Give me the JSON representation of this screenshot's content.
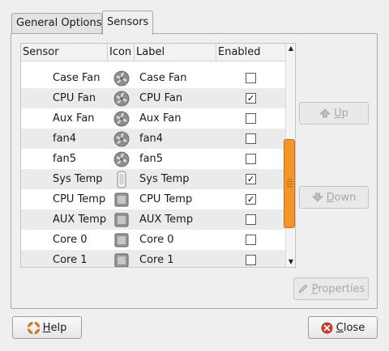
{
  "tabs": [
    {
      "label": "General Options",
      "active": false
    },
    {
      "label": "Sensors",
      "active": true
    }
  ],
  "table": {
    "columns": [
      "Sensor",
      "Icon",
      "Label",
      "Enabled"
    ],
    "rows": [
      {
        "sensor": "Case Fan",
        "icon": "fan-icon",
        "label": "Case Fan",
        "enabled": false
      },
      {
        "sensor": "CPU Fan",
        "icon": "fan-icon",
        "label": "CPU Fan",
        "enabled": true
      },
      {
        "sensor": "Aux Fan",
        "icon": "fan-icon",
        "label": "Aux Fan",
        "enabled": false
      },
      {
        "sensor": "fan4",
        "icon": "fan-icon",
        "label": "fan4",
        "enabled": false
      },
      {
        "sensor": "fan5",
        "icon": "fan-icon",
        "label": "fan5",
        "enabled": false
      },
      {
        "sensor": "Sys Temp",
        "icon": "thermometer-icon",
        "label": "Sys Temp",
        "enabled": true
      },
      {
        "sensor": "CPU Temp",
        "icon": "chip-icon",
        "label": "CPU Temp",
        "enabled": true
      },
      {
        "sensor": "AUX Temp",
        "icon": "chip-icon",
        "label": "AUX Temp",
        "enabled": false
      },
      {
        "sensor": "Core 0",
        "icon": "chip-icon",
        "label": "Core 0",
        "enabled": false
      },
      {
        "sensor": "Core 1",
        "icon": "chip-icon",
        "label": "Core 1",
        "enabled": false
      }
    ]
  },
  "buttons": {
    "up": {
      "pre": "",
      "u": "U",
      "post": "p"
    },
    "down": {
      "pre": "",
      "u": "D",
      "post": "own"
    },
    "properties": {
      "pre": "",
      "u": "P",
      "post": "roperties"
    },
    "help": {
      "pre": "",
      "u": "H",
      "post": "elp"
    },
    "close": {
      "pre": "",
      "u": "C",
      "post": "lose"
    }
  },
  "colors": {
    "scroll_accent": "#f0962a",
    "close_icon": "#d83a2a",
    "help_icon": "#e07a20"
  }
}
